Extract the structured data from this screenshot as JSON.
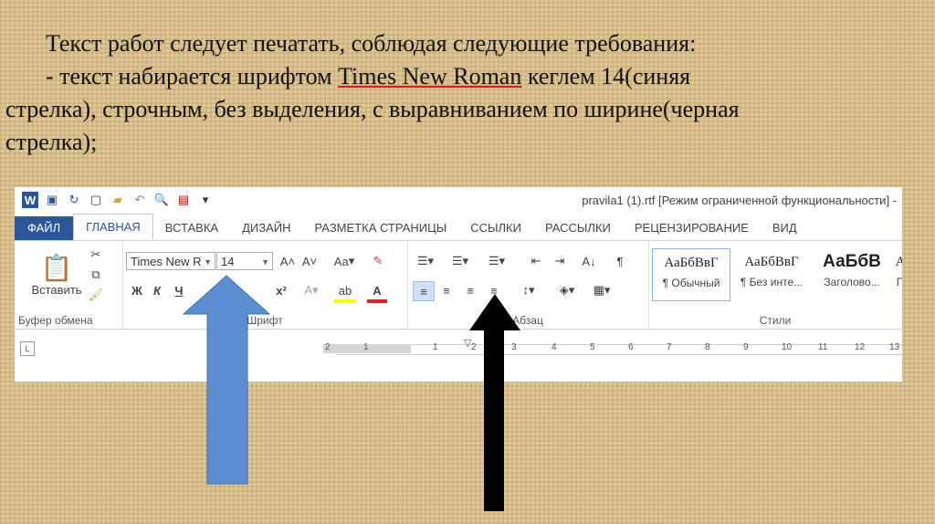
{
  "slide": {
    "line1": "Текст работ следует печатать, соблюдая следующие требования:",
    "line2_prefix": "- текст набирается шрифтом ",
    "line2_font": "Times New Roman",
    "line2_suffix": " кеглем 14(синяя",
    "line3": "стрелка), строчным, без выделения, с выравниванием по ширине(черная",
    "line4": "стрелка);"
  },
  "word": {
    "title": "pravila1 (1).rtf [Режим ограниченной функциональности] -",
    "tabs": [
      "ФАЙЛ",
      "ГЛАВНАЯ",
      "ВСТАВКА",
      "ДИЗАЙН",
      "РАЗМЕТКА СТРАНИЦЫ",
      "ССЫЛКИ",
      "РАССЫЛКИ",
      "РЕЦЕНЗИРОВАНИЕ",
      "ВИД"
    ],
    "active_tab": "ГЛАВНАЯ",
    "clipboard": {
      "paste_label": "Вставить",
      "group_label": "Буфер обмена"
    },
    "font": {
      "name": "Times New R",
      "size": "14",
      "group_label": "Шрифт",
      "bold": "Ж",
      "italic": "К",
      "underline": "Ч",
      "superscript": "x²",
      "change_case": "Aa"
    },
    "paragraph": {
      "group_label": "Абзац"
    },
    "styles": {
      "group_label": "Стили",
      "items": [
        {
          "sample": "АаБбВвГ",
          "name": "¶ Обычный"
        },
        {
          "sample": "АаБбВвГ",
          "name": "¶ Без инте..."
        },
        {
          "sample": "АаБбВ",
          "name": "Заголово..."
        },
        {
          "sample": "А",
          "name": "П"
        }
      ]
    },
    "ruler_ticks": [
      "2",
      "1",
      "1",
      "2",
      "3",
      "4",
      "5",
      "6",
      "7",
      "8",
      "9",
      "10",
      "11",
      "12",
      "13"
    ]
  },
  "colors": {
    "word_blue": "#2b579a",
    "arrow_blue": "#5b8fd1",
    "arrow_black": "#000000",
    "highlight_yellow": "#ffff00",
    "font_red": "#e02020"
  }
}
